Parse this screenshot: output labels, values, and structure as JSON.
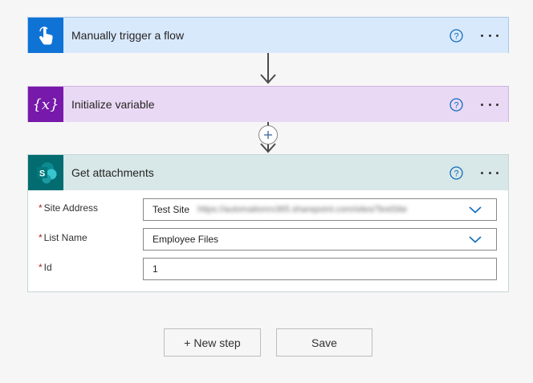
{
  "steps": [
    {
      "title": "Manually trigger a flow",
      "icon": "hand-tap-icon",
      "color": "#0f73d6"
    },
    {
      "title": "Initialize variable",
      "icon": "variable-icon",
      "color": "#7719aa",
      "icon_text": "{x}"
    },
    {
      "title": "Get attachments",
      "icon": "sharepoint-icon",
      "color": "#036c70",
      "icon_text": "S"
    }
  ],
  "form": {
    "fields": [
      {
        "label": "Site Address",
        "value": "Test Site",
        "secondary": "https://automationrx365.sharepoint.com/sites/TestSite"
      },
      {
        "label": "List Name",
        "value": "Employee Files"
      },
      {
        "label": "Id",
        "value": "1"
      }
    ],
    "required_marker": "*"
  },
  "buttons": {
    "new_step": "+ New step",
    "save": "Save"
  },
  "colors": {
    "help": "#0f6cbd",
    "required": "#a4262c",
    "chevron": "#0f6cbd"
  }
}
